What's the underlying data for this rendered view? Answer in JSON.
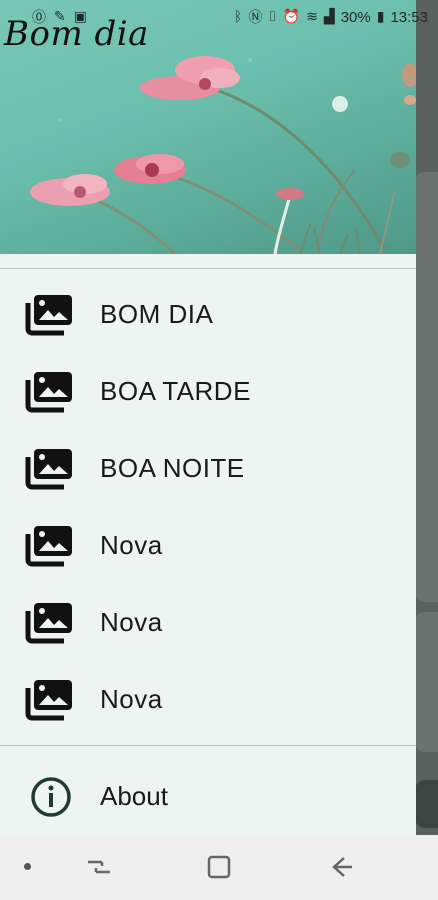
{
  "status_bar": {
    "battery_percent": "30%",
    "time": "13:53",
    "left_icons": [
      "notification-icon-1",
      "notification-icon-2",
      "notification-icon-3"
    ],
    "right_icons": [
      "bluetooth-icon",
      "nfc-icon",
      "vibrate-icon",
      "alarm-icon",
      "wifi-icon",
      "signal-icon",
      "battery-icon"
    ]
  },
  "drawer": {
    "header_title": "Bom dia",
    "items": [
      {
        "label": "BOM DIA",
        "icon": "image-collection-icon"
      },
      {
        "label": "BOA TARDE",
        "icon": "image-collection-icon"
      },
      {
        "label": "BOA NOITE",
        "icon": "image-collection-icon"
      },
      {
        "label": "Nova",
        "icon": "image-collection-icon"
      },
      {
        "label": "Nova",
        "icon": "image-collection-icon"
      },
      {
        "label": "Nova",
        "icon": "image-collection-icon"
      }
    ],
    "about": {
      "label": "About",
      "icon": "info-icon"
    }
  },
  "nav_bar": {
    "icons": [
      "dot-icon",
      "recent-apps-icon",
      "home-icon",
      "back-icon"
    ]
  },
  "colors": {
    "drawer_background": "#eef4f2",
    "header_teal": "#6cbfae",
    "text": "#1a1a1a",
    "icon": "#111111",
    "flower_pink": "#e6899a"
  }
}
